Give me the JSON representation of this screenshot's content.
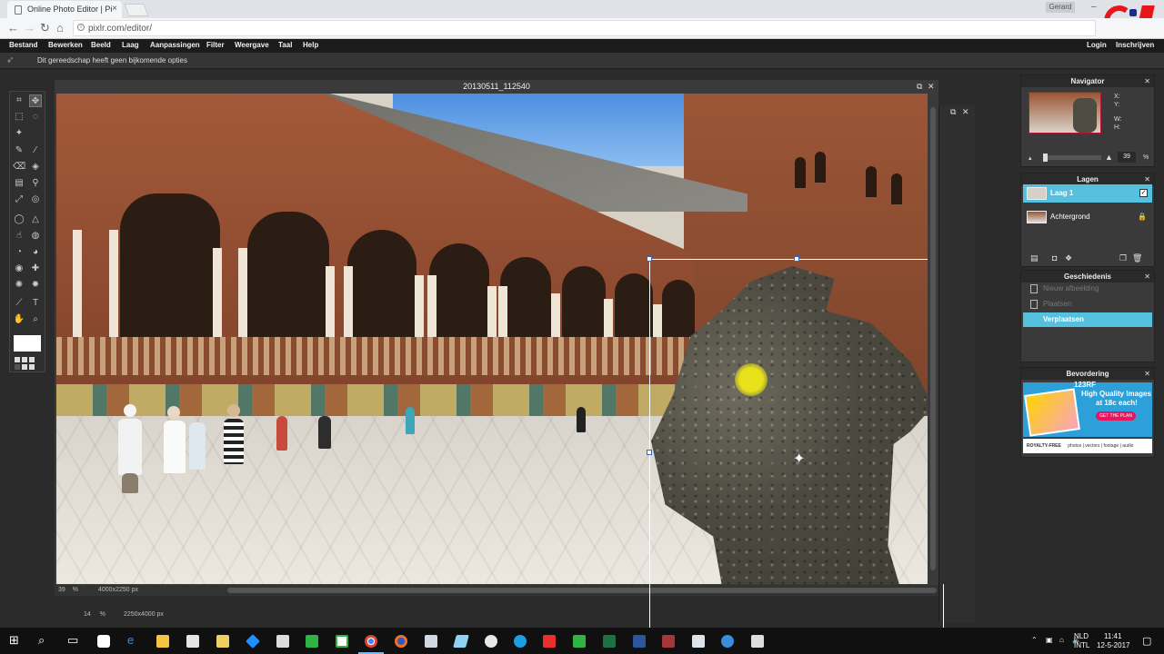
{
  "browser": {
    "tab_title": "Online Photo Editor | Pi",
    "tab_close": "×",
    "url": "pixlr.com/editor/",
    "user": "Gerard",
    "nav": {
      "back": "←",
      "forward": "→",
      "reload": "↻",
      "home": "⌂"
    },
    "window_controls": {
      "minimize": "–",
      "maximize": "☐"
    }
  },
  "menubar": {
    "items": [
      "Bestand",
      "Bewerken",
      "Beeld",
      "Laag",
      "Aanpassingen",
      "Filter",
      "Weergave",
      "Taal",
      "Help"
    ],
    "login": "Login",
    "signup": "Inschrijven"
  },
  "options_bar": {
    "message": "Dit gereedschap heeft geen bijkomende opties"
  },
  "document": {
    "title": "20130511_112540",
    "zoom": "39",
    "zoom_unit": "%",
    "dimensions": "4000x2250 px"
  },
  "second_document": {
    "zoom": "14",
    "zoom_unit": "%",
    "dimensions": "2250x4000 px"
  },
  "navigator": {
    "title": "Navigator",
    "x_label": "X:",
    "y_label": "Y:",
    "w_label": "W:",
    "h_label": "H:",
    "zoom": "39",
    "zoom_unit": "%"
  },
  "layers": {
    "title": "Lagen",
    "items": [
      {
        "name": "Laag 1",
        "selected": true
      },
      {
        "name": "Achtergrond",
        "selected": false
      }
    ]
  },
  "history": {
    "title": "Geschiedenis",
    "items": [
      {
        "label": "Nieuw afbeelding",
        "selected": false
      },
      {
        "label": "Plaatsen",
        "selected": false
      },
      {
        "label": "Verplaatsen",
        "selected": true
      }
    ]
  },
  "promotion": {
    "title": "Bevordering",
    "brand": "123RF",
    "line1": "High Quality Images",
    "line2": "at 18c each!",
    "cta": "GET THE PLAN",
    "footer_brand": "ROYALTY-FREE",
    "footer_text": "photos | vectors | footage | audio"
  },
  "taskbar": {
    "tray_lang": "NLD",
    "tray_lang2": "INTL",
    "time": "11:41",
    "date": "12-5-2017"
  },
  "colors": {
    "accent": "#56c1de",
    "menubar": "#1b1b1b",
    "panel": "#3a3a3a"
  }
}
